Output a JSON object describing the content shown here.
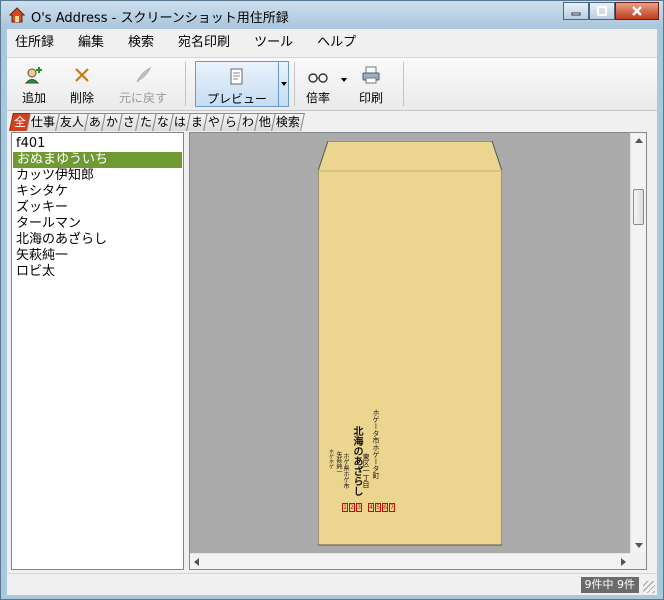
{
  "window": {
    "title": "O's Address - スクリーンショット用住所録"
  },
  "menu": [
    "住所録",
    "編集",
    "検索",
    "宛名印刷",
    "ツール",
    "ヘルプ"
  ],
  "toolbar": {
    "add_label": "追加",
    "delete_label": "削除",
    "undo_label": "元に戻す",
    "preview_label": "プレビュー",
    "zoom_label": "倍率",
    "print_label": "印刷"
  },
  "tabs": [
    "全",
    "仕事",
    "友人",
    "あ",
    "か",
    "さ",
    "た",
    "な",
    "は",
    "ま",
    "や",
    "ら",
    "わ",
    "他",
    "検索"
  ],
  "contacts": [
    "f401",
    "おぬまゆういち",
    "カッツ伊知郎",
    "キシタケ",
    "ズッキー",
    "タールマン",
    "北海のあざらし",
    "矢萩純一",
    "ロビ太"
  ],
  "selected_contact_index": 1,
  "envelope": {
    "color": "#ecd58e",
    "address_line1": "ホゲータ市ホゲータ町",
    "address_line2": "東区一丁目",
    "recipient_name": "北海のあざらし",
    "sender_line1": "ホゲ県ホゲ市",
    "sender_line2": "矢萩純一",
    "sender_line3": "ホゲホゲ",
    "postal_code": "1234567"
  },
  "status": {
    "count_text": "9件中 9件"
  },
  "colors": {
    "selected_tab": "#d2401e",
    "selected_row": "#6f9a33",
    "envelope": "#ecd58e"
  }
}
